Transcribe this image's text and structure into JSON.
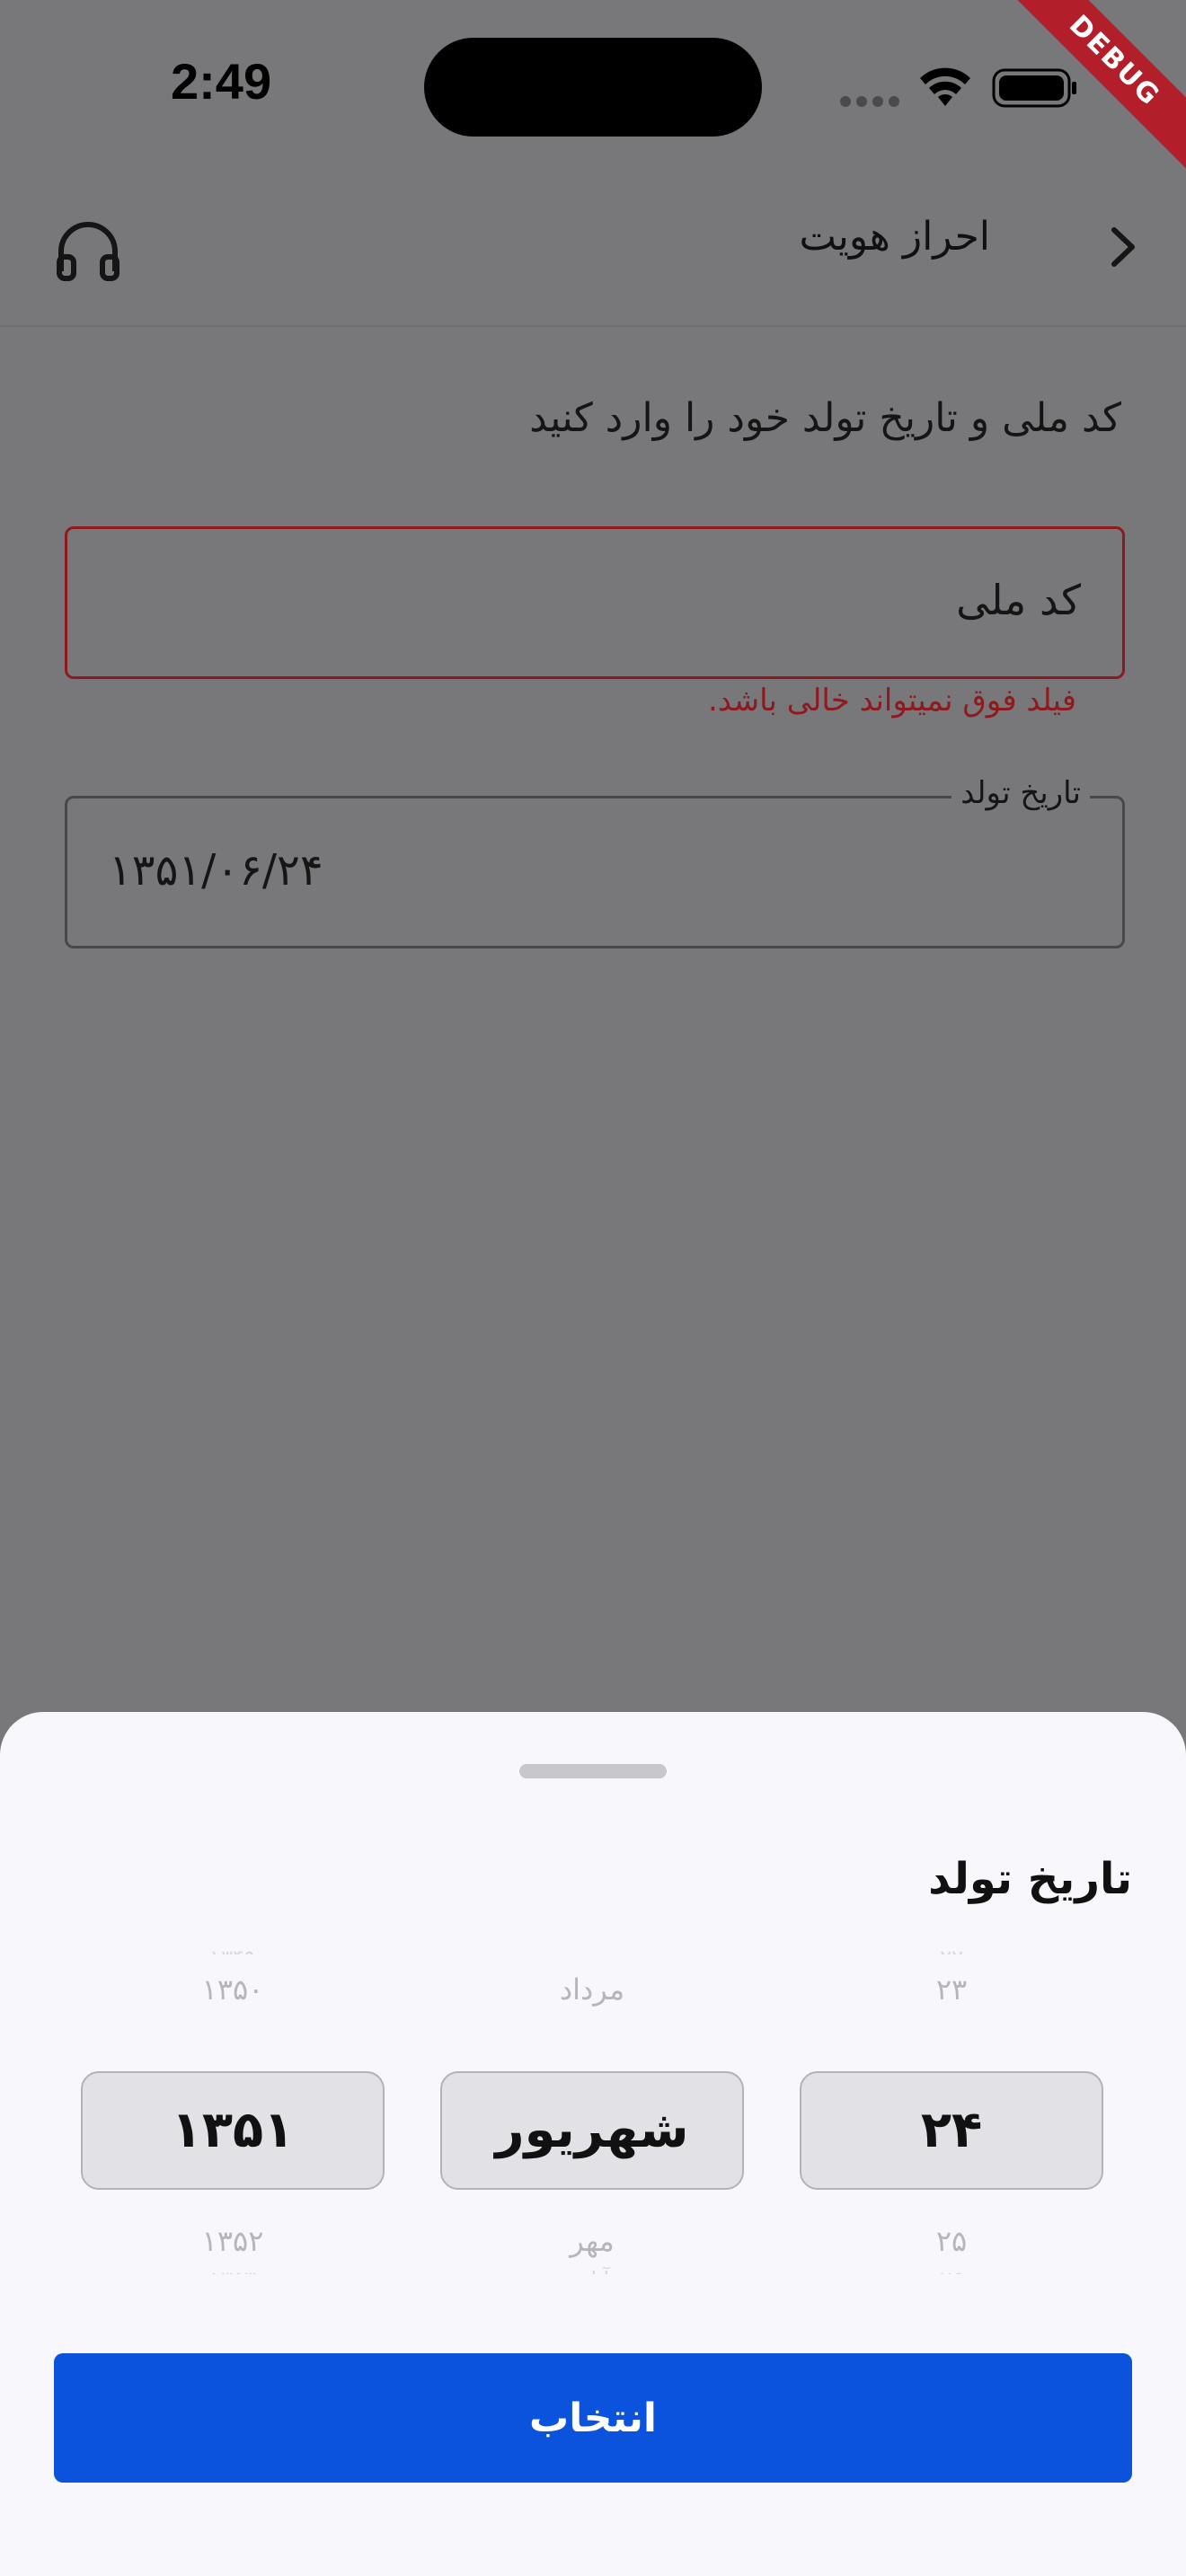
{
  "status": {
    "time": "2:49",
    "debug_label": "DEBUG"
  },
  "appbar": {
    "title": "احراز هویت",
    "back_icon": "chevron-right-icon",
    "support_icon": "headphones-icon"
  },
  "form": {
    "instruction": "کد ملی و تاریخ تولد خود را وارد کنید",
    "national_code": {
      "placeholder": "کد ملی",
      "error": "فیلد فوق نمیتواند خالی باشد."
    },
    "birth_date": {
      "label": "تاریخ تولد",
      "value": "۱۳۵۱/۰۶/۲۴"
    }
  },
  "sheet": {
    "title": "تاریخ تولد",
    "year": {
      "above": "۱۳۵۰",
      "selected": "۱۳۵۱",
      "below": "۱۳۵۲"
    },
    "month": {
      "above": "مرداد",
      "selected": "شهریور",
      "below": "مهر"
    },
    "day": {
      "above": "۲۳",
      "selected": "۲۴",
      "below": "۲۵"
    },
    "confirm_label": "انتخاب"
  },
  "colors": {
    "primary": "#0b53dd",
    "error": "#8e1a1f",
    "scrim": "#78787b",
    "sheet": "#f8f7fc"
  }
}
